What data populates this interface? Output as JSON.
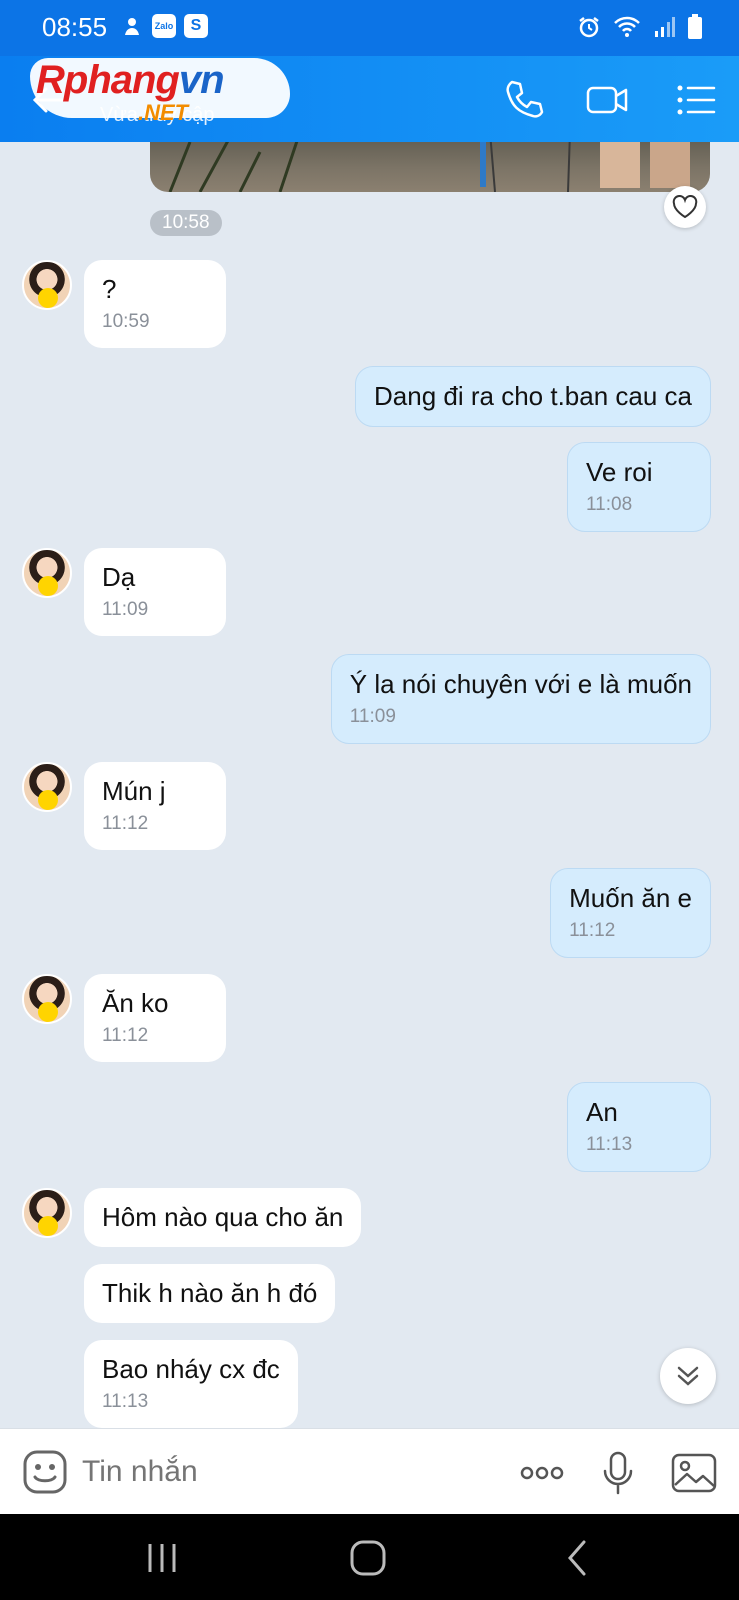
{
  "status_bar": {
    "time": "08:55",
    "notifs": [
      "Zalo",
      "S"
    ]
  },
  "header": {
    "contact_name": "",
    "contact_status": "Vừa truy cập",
    "watermark": {
      "main": "Rphang",
      "accent": "vn",
      "suffix": ".NET"
    }
  },
  "chat": {
    "photo_time": "10:58",
    "messages": [
      {
        "dir": "in",
        "text": "?",
        "time": "10:59"
      },
      {
        "dir": "out",
        "text": "Dang đi ra cho t.ban cau ca",
        "time": ""
      },
      {
        "dir": "out",
        "text": "Ve roi",
        "time": "11:08"
      },
      {
        "dir": "in",
        "text": "Dạ",
        "time": "11:09"
      },
      {
        "dir": "out",
        "text": "Ý la nói chuyên với e là muốn",
        "time": "11:09"
      },
      {
        "dir": "in",
        "text": "Mún j",
        "time": "11:12"
      },
      {
        "dir": "out",
        "text": "Muốn ăn e",
        "time": "11:12"
      },
      {
        "dir": "in",
        "text": "Ăn ko",
        "time": "11:12"
      },
      {
        "dir": "out",
        "text": "An",
        "time": "11:13"
      },
      {
        "dir": "in",
        "text": "Hôm nào qua cho ăn",
        "time": ""
      },
      {
        "dir": "in",
        "text": "Thik h nào ăn h đó",
        "time": ""
      },
      {
        "dir": "in",
        "text": "Bao nháy cx đc",
        "time": "11:13"
      }
    ]
  },
  "input": {
    "placeholder": "Tin nhắn"
  },
  "colors": {
    "header": "#0c74e6",
    "chat_bg": "#e2e9f1",
    "out_bubble": "#d5ecfd",
    "in_bubble": "#ffffff"
  }
}
